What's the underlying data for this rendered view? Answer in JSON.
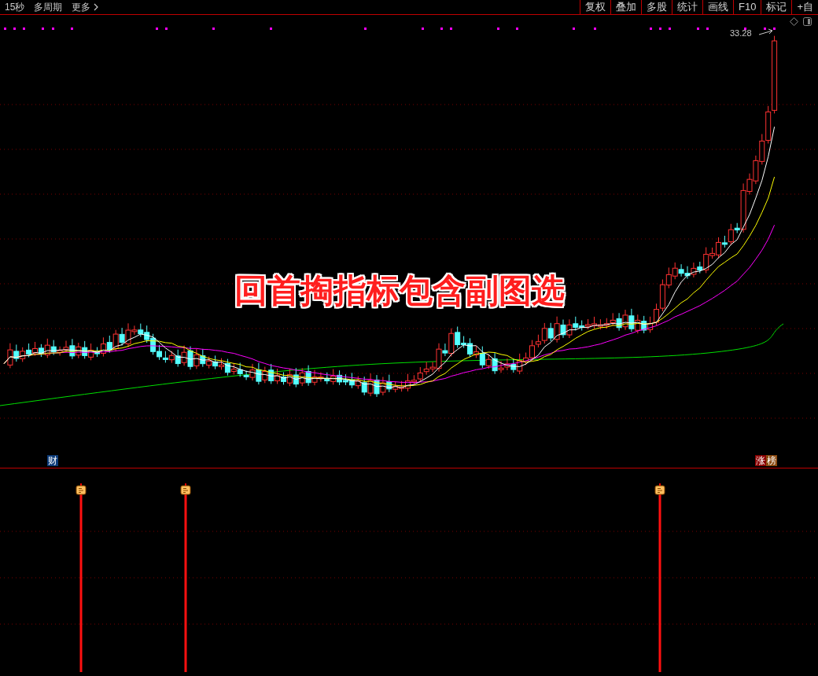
{
  "toolbar": {
    "left_items": [
      {
        "label": "15秒"
      },
      {
        "label": "多周期"
      },
      {
        "label": "更多"
      }
    ],
    "right_buttons": [
      {
        "label": "复权"
      },
      {
        "label": "叠加"
      },
      {
        "label": "多股"
      },
      {
        "label": "统计"
      },
      {
        "label": "画线"
      },
      {
        "label": "F10"
      },
      {
        "label": "标记"
      },
      {
        "label": "+自"
      }
    ]
  },
  "main_chart": {
    "price_label": "33.28",
    "caption": "回首掏指标包含副图选",
    "markers": [
      {
        "label": "财",
        "color": "#0b3a78"
      },
      {
        "label": "涨",
        "color": "#8b0000"
      },
      {
        "label": "榜",
        "color": "#8b4a10"
      }
    ]
  }
}
